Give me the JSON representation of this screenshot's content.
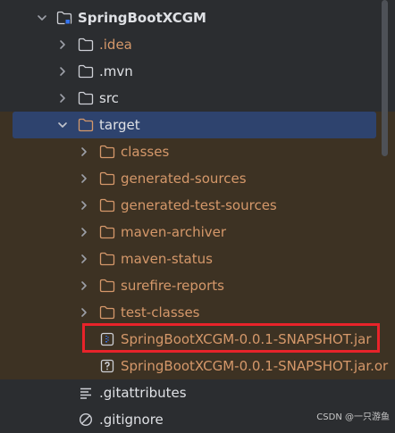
{
  "project_tree": {
    "root": {
      "label": "SpringBootXCGM"
    },
    "items": [
      {
        "label": ".idea"
      },
      {
        "label": ".mvn"
      },
      {
        "label": "src"
      },
      {
        "label": "target"
      },
      {
        "label": "classes"
      },
      {
        "label": "generated-sources"
      },
      {
        "label": "generated-test-sources"
      },
      {
        "label": "maven-archiver"
      },
      {
        "label": "maven-status"
      },
      {
        "label": "surefire-reports"
      },
      {
        "label": "test-classes"
      },
      {
        "label": "SpringBootXCGM-0.0.1-SNAPSHOT.jar"
      },
      {
        "label": "SpringBootXCGM-0.0.1-SNAPSHOT.jar.or"
      },
      {
        "label": ".gitattributes"
      },
      {
        "label": ".gitignore"
      }
    ]
  },
  "colors": {
    "background": "#2b2d30",
    "excluded_background": "#3d3223",
    "selected_background": "#2e436e",
    "excluded_text": "#d5986a",
    "normal_text": "#dfe1e5",
    "highlight_border": "#e8232a",
    "jar_icon": "#3574f0"
  },
  "watermark": "CSDN @一只游鱼"
}
